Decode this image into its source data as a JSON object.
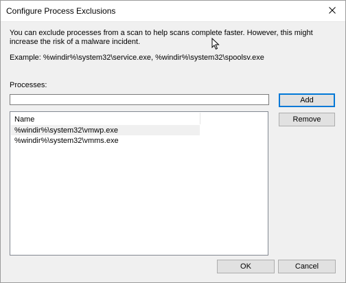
{
  "window": {
    "title": "Configure Process Exclusions",
    "close_icon": "close-icon"
  },
  "description": "You can exclude processes from a scan to help scans complete faster. However, this might increase the risk of a malware incident.",
  "example": "Example: %windir%\\system32\\service.exe, %windir%\\system32\\spoolsv.exe",
  "processes": {
    "label": "Processes:",
    "input_value": ""
  },
  "buttons": {
    "add": "Add",
    "remove": "Remove",
    "ok": "OK",
    "cancel": "Cancel"
  },
  "list": {
    "header": "Name",
    "items": [
      "%windir%\\system32\\vmwp.exe",
      "%windir%\\system32\\vmms.exe"
    ]
  },
  "colors": {
    "accent": "#0078d7",
    "dialog_bg": "#f0f0f0"
  }
}
